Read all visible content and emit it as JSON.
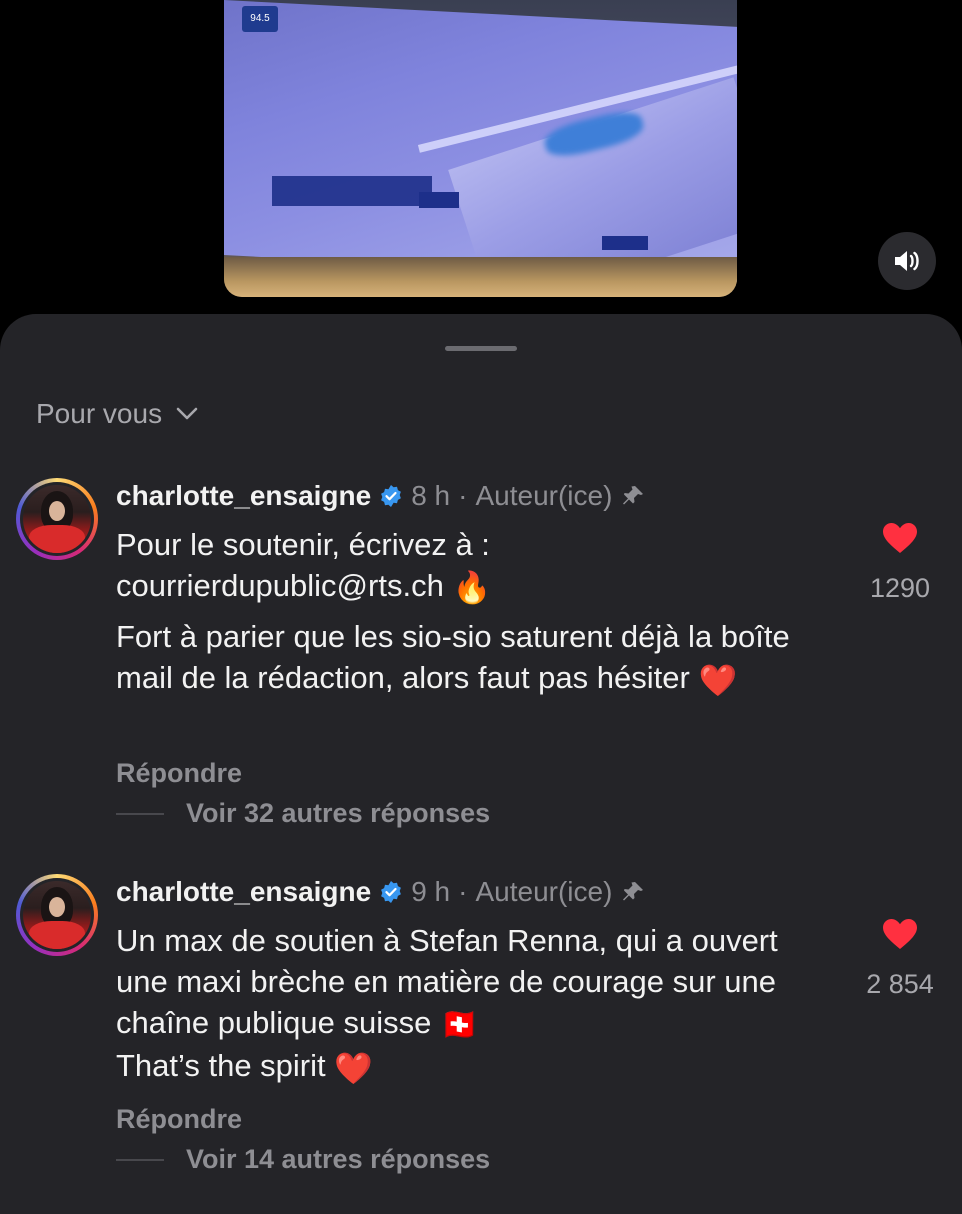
{
  "video": {
    "badge": "94.5",
    "sound_icon": "speaker-icon"
  },
  "sheet": {
    "filter_label": "Pour vous",
    "filter_icon": "chevron-down-icon"
  },
  "comments": [
    {
      "username": "charlotte_ensaigne",
      "time": "8 h",
      "separator": "·",
      "author_tag": "Auteur(ice)",
      "line1": "Pour le soutenir, écrivez à :",
      "line2": "courrierdupublic@rts.ch",
      "emoji1": "🔥",
      "para2": "Fort à parier que les sio-sio saturent déjà la boîte mail de la rédaction, alors faut pas hésiter",
      "emoji2": "❤️",
      "likes": "1290",
      "reply_label": "Répondre",
      "more_replies": "Voir 32 autres réponses"
    },
    {
      "username": "charlotte_ensaigne",
      "time": "9 h",
      "separator": "·",
      "author_tag": "Auteur(ice)",
      "para1": "Un max de soutien à Stefan Renna, qui a ouvert une maxi brèche en matière de courage sur une chaîne publique suisse",
      "flag": "🇨🇭",
      "para2": "That’s the spirit",
      "emoji2": "❤️",
      "likes": "2 854",
      "reply_label": "Répondre",
      "more_replies": "Voir 14 autres réponses"
    }
  ],
  "colors": {
    "sheet_bg": "#242428",
    "like_red": "#ff3040",
    "verified_blue": "#3897f0"
  }
}
